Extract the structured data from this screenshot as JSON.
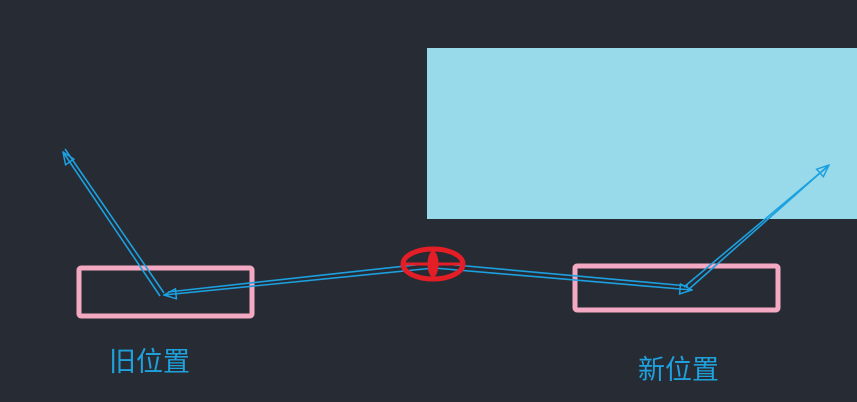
{
  "labels": {
    "old_position": "旧位置",
    "new_position": "新位置"
  },
  "colors": {
    "background": "#272b33",
    "panel": "#98dae9",
    "box_outline": "#f4a9c3",
    "arrow": "#1ca0e0",
    "origin_marker": "#e41e26",
    "label_text": "#1fa1dd"
  },
  "icons": {
    "origin_marker": "red-ellipse-marker-icon",
    "arrows": "outlined-arrowhead-icon"
  }
}
